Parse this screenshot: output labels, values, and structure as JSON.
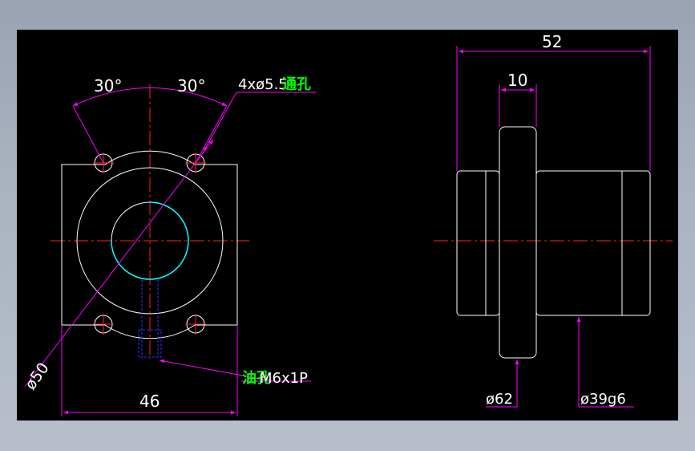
{
  "colors": {
    "background": "#000000",
    "outline": "#ffffff",
    "dimension": "#ff00ff",
    "centerline": "#ff2020",
    "dim_text": "#ffffff",
    "label_text": "#00ff00",
    "thread": "#00ffff",
    "hidden": "#3030ff"
  },
  "left_view": {
    "angle_left": "30°",
    "angle_right": "30°",
    "holes_label": "4xø5.5",
    "holes_suffix": "通孔",
    "pcd_label": "ø50",
    "width_label": "46",
    "oil_prefix": "油孔",
    "oil_spec": "M6x1P"
  },
  "right_view": {
    "overall_length": "52",
    "flange_thickness": "10",
    "flange_diameter": "ø62",
    "body_diameter": "ø39g6"
  }
}
